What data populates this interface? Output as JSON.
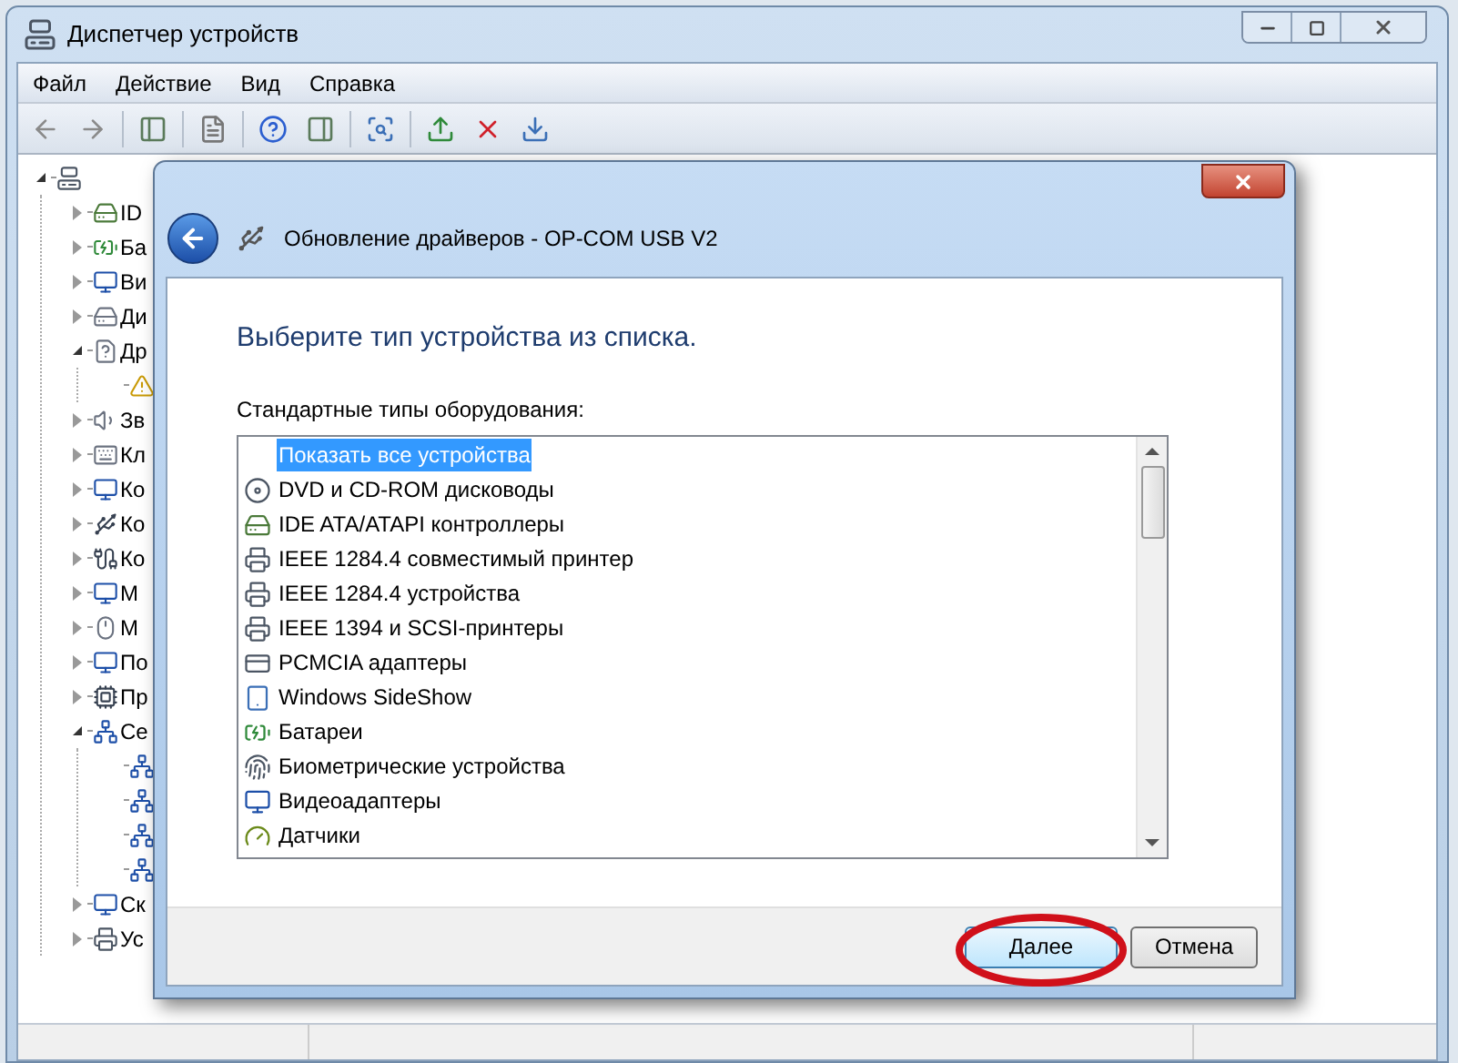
{
  "window": {
    "title": "Диспетчер устройств",
    "menu": [
      "Файл",
      "Действие",
      "Вид",
      "Справка"
    ]
  },
  "tree": [
    {
      "kind": "computer",
      "expanded": true,
      "children": [
        {
          "label": "ID",
          "kind": "ide",
          "expanded": false
        },
        {
          "label": "Ба",
          "kind": "battery",
          "expanded": false
        },
        {
          "label": "Ви",
          "kind": "display",
          "expanded": false
        },
        {
          "label": "Ди",
          "kind": "disk",
          "expanded": false
        },
        {
          "label": "Др",
          "kind": "unknown",
          "expanded": true,
          "children": [
            {
              "kind": "warning"
            }
          ]
        },
        {
          "label": "Зв",
          "kind": "sound",
          "expanded": false
        },
        {
          "label": "Кл",
          "kind": "keyboard",
          "expanded": false
        },
        {
          "label": "Ко",
          "kind": "monitor",
          "expanded": false
        },
        {
          "label": "Ко",
          "kind": "usb",
          "expanded": false
        },
        {
          "label": "Ко",
          "kind": "port",
          "expanded": false
        },
        {
          "label": "М",
          "kind": "monitor",
          "expanded": false
        },
        {
          "label": "М",
          "kind": "mouse",
          "expanded": false
        },
        {
          "label": "По",
          "kind": "display",
          "expanded": false
        },
        {
          "label": "Пр",
          "kind": "cpu",
          "expanded": false
        },
        {
          "label": "Се",
          "kind": "network",
          "expanded": true,
          "children": [
            {
              "kind": "network"
            },
            {
              "kind": "network"
            },
            {
              "kind": "network"
            },
            {
              "kind": "network"
            }
          ]
        },
        {
          "label": "Ск",
          "kind": "monitor",
          "expanded": false
        },
        {
          "label": "Ус",
          "kind": "printer",
          "expanded": false
        }
      ]
    }
  ],
  "dialog": {
    "title": "Обновление драйверов - OP-COM USB V2",
    "heading": "Выберите тип устройства из списка.",
    "list_label": "Стандартные типы оборудования:",
    "items": [
      {
        "label": "Показать все устройства",
        "kind": "none",
        "selected": true
      },
      {
        "label": "DVD и CD-ROM дисководы",
        "kind": "dvd",
        "selected": false
      },
      {
        "label": "IDE ATA/ATAPI контроллеры",
        "kind": "ide",
        "selected": false
      },
      {
        "label": "IEEE 1284.4 совместимый принтер",
        "kind": "printer",
        "selected": false
      },
      {
        "label": "IEEE 1284.4 устройства",
        "kind": "printer",
        "selected": false
      },
      {
        "label": "IEEE 1394 и SCSI-принтеры",
        "kind": "printer",
        "selected": false
      },
      {
        "label": "PCMCIA адаптеры",
        "kind": "pcmcia",
        "selected": false
      },
      {
        "label": "Windows SideShow",
        "kind": "sideshow",
        "selected": false
      },
      {
        "label": "Батареи",
        "kind": "battery",
        "selected": false
      },
      {
        "label": "Биометрические устройства",
        "kind": "biometric",
        "selected": false
      },
      {
        "label": "Видеоадаптеры",
        "kind": "display",
        "selected": false
      },
      {
        "label": "Датчики",
        "kind": "sensor",
        "selected": false
      }
    ],
    "buttons": [
      {
        "label": "Далее",
        "default": true
      },
      {
        "label": "Отмена",
        "default": false
      }
    ]
  }
}
